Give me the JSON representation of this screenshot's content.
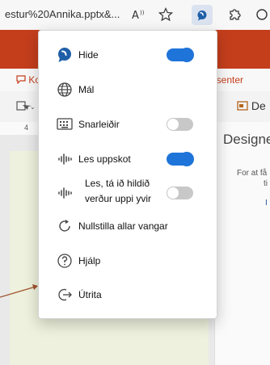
{
  "browser": {
    "url_text": "estur%20Annika.pptx&...",
    "read_aloud_icon": "read-aloud-icon",
    "favorite_icon": "star-icon",
    "extension_icon": "speech-bubble-icon",
    "extensions_icon": "puzzle-icon",
    "sync_icon": "circle-icon"
  },
  "office": {
    "ribbon_left_fragment": "Ko",
    "ribbon_right_fragment": "æsenter",
    "tool_right_fragment": "De",
    "ruler_number": "4",
    "designer": {
      "title": "Designe",
      "text_line1": "For at få",
      "text_line2": "ti",
      "link_fragment": "I"
    },
    "accent_color": "#c43e1c"
  },
  "menu": {
    "items": [
      {
        "label": "Hide",
        "icon": "speech-bubble-icon",
        "toggle": "on"
      },
      {
        "label": "Mál",
        "icon": "globe-icon"
      },
      {
        "label": "Snarleiðir",
        "icon": "keyboard-icon",
        "toggle": "off"
      },
      {
        "label": "Les uppskot",
        "icon": "sound-wave-icon",
        "toggle": "on"
      },
      {
        "label_line1": "Les, tá ið hildið",
        "label_line2": "verður uppi yvir",
        "icon": "sound-wave-icon",
        "toggle": "off"
      },
      {
        "label": "Nullstilla allar vangar",
        "icon": "reset-icon"
      },
      {
        "label": "Hjálp",
        "icon": "help-icon"
      },
      {
        "label": "Útrita",
        "icon": "sign-out-icon"
      }
    ],
    "toggle_on_color": "#1f74d9"
  }
}
